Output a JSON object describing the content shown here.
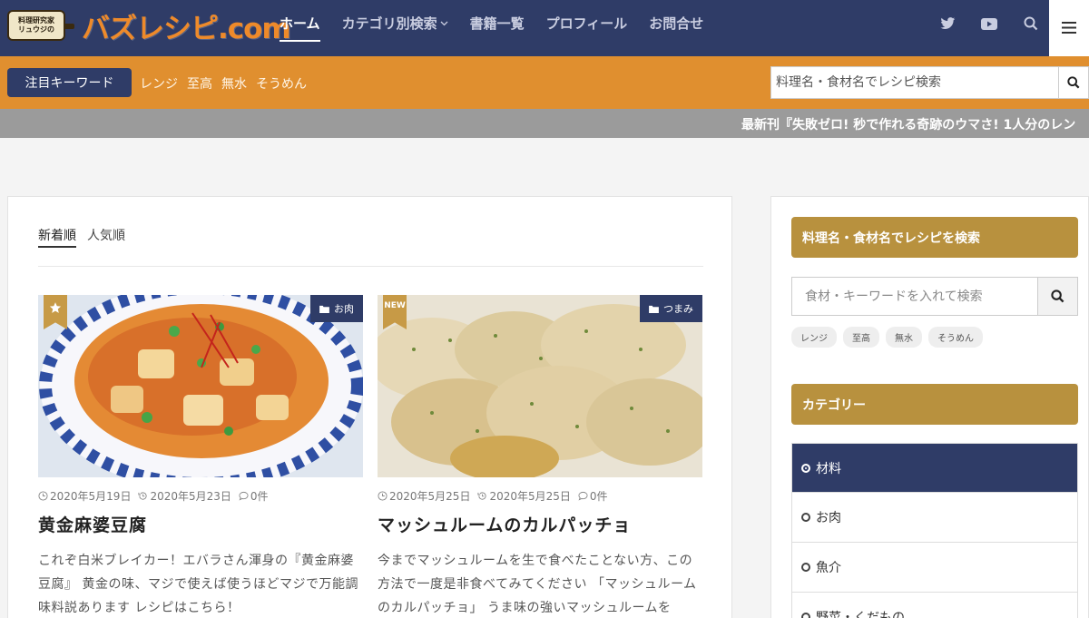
{
  "header": {
    "logo_badge_line1": "料理研究家",
    "logo_badge_line2": "リュウジの",
    "logo_text": "バズレシピ.com",
    "nav": [
      {
        "label": "ホーム"
      },
      {
        "label": "カテゴリ別検索"
      },
      {
        "label": "書籍一覧"
      },
      {
        "label": "プロフィール"
      },
      {
        "label": "お問合せ"
      }
    ],
    "icons": [
      "twitter-icon",
      "youtube-icon",
      "search-icon",
      "menu-icon"
    ]
  },
  "keyword_bar": {
    "label": "注目キーワード",
    "keywords": [
      "レンジ",
      "至高",
      "無水",
      "そうめん"
    ],
    "search_placeholder": "料理名・食材名でレシピ検索"
  },
  "ticker": {
    "text": "最新刊『失敗ゼロ! 秒で作れる奇跡のウマさ! 1人分のレン"
  },
  "main": {
    "tabs": [
      {
        "label": "新着順"
      },
      {
        "label": "人気順"
      }
    ],
    "posts": [
      {
        "category": "お肉",
        "flag": "star",
        "published": "2020年5月19日",
        "updated": "2020年5月23日",
        "comments": "0件",
        "title": "黄金麻婆豆腐",
        "description": "これぞ白米ブレイカー！エバラさん渾身の『黄金麻婆豆腐』 黄金の味、マジで使えば使うほどマジで万能調味料説あります レシピはこちら！"
      },
      {
        "category": "つまみ",
        "flag": "NEW",
        "published": "2020年5月25日",
        "updated": "2020年5月25日",
        "comments": "0件",
        "title": "マッシュルームのカルパッチョ",
        "description": "今までマッシュルームを生で食べたことない方、この方法で一度是非食べてみてください 「マッシュルームのカルパッチョ」 うま味の強いマッシュルームを"
      }
    ]
  },
  "sidebar": {
    "search_heading": "料理名・食材名でレシピを検索",
    "search_placeholder": "食材・キーワードを入れて検索",
    "tags": [
      "レンジ",
      "至高",
      "無水",
      "そうめん"
    ],
    "category_heading": "カテゴリー",
    "categories": [
      {
        "label": "材料"
      },
      {
        "label": "お肉"
      },
      {
        "label": "魚介"
      },
      {
        "label": "野菜・くだもの"
      }
    ]
  },
  "colors": {
    "navy": "#2f3c67",
    "orange": "#e08f2f",
    "gold": "#b8913e",
    "logo_orange": "#ee8a2a"
  }
}
